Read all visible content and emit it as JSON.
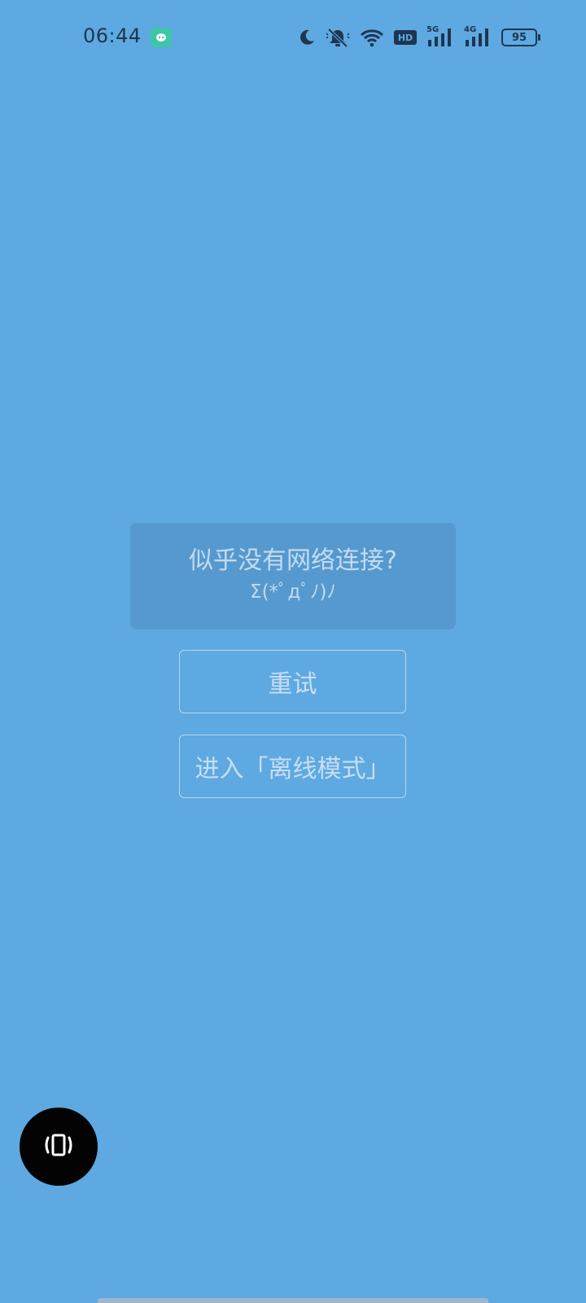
{
  "status_bar": {
    "time": "06:44",
    "network_5g_label": "5G",
    "network_4g_label": "4G",
    "hd_label": "HD",
    "battery_level": "95",
    "icons": [
      "notification-app-icon",
      "moon-icon",
      "mute-bell-icon",
      "wifi-icon",
      "hd-icon",
      "signal-5g-icon",
      "signal-4g-icon",
      "battery-icon"
    ]
  },
  "message": {
    "title": "似乎没有网络连接?",
    "face": "Σ(*ﾟдﾟﾉ)ﾉ"
  },
  "buttons": {
    "retry_label": "重试",
    "offline_label": "进入「离线模式」"
  },
  "fab": {
    "icon": "vibrate-icon"
  },
  "colors": {
    "background": "#5ea9e1",
    "card": "#5599ce",
    "text": "#c3dbf1",
    "fab": "#030303"
  }
}
